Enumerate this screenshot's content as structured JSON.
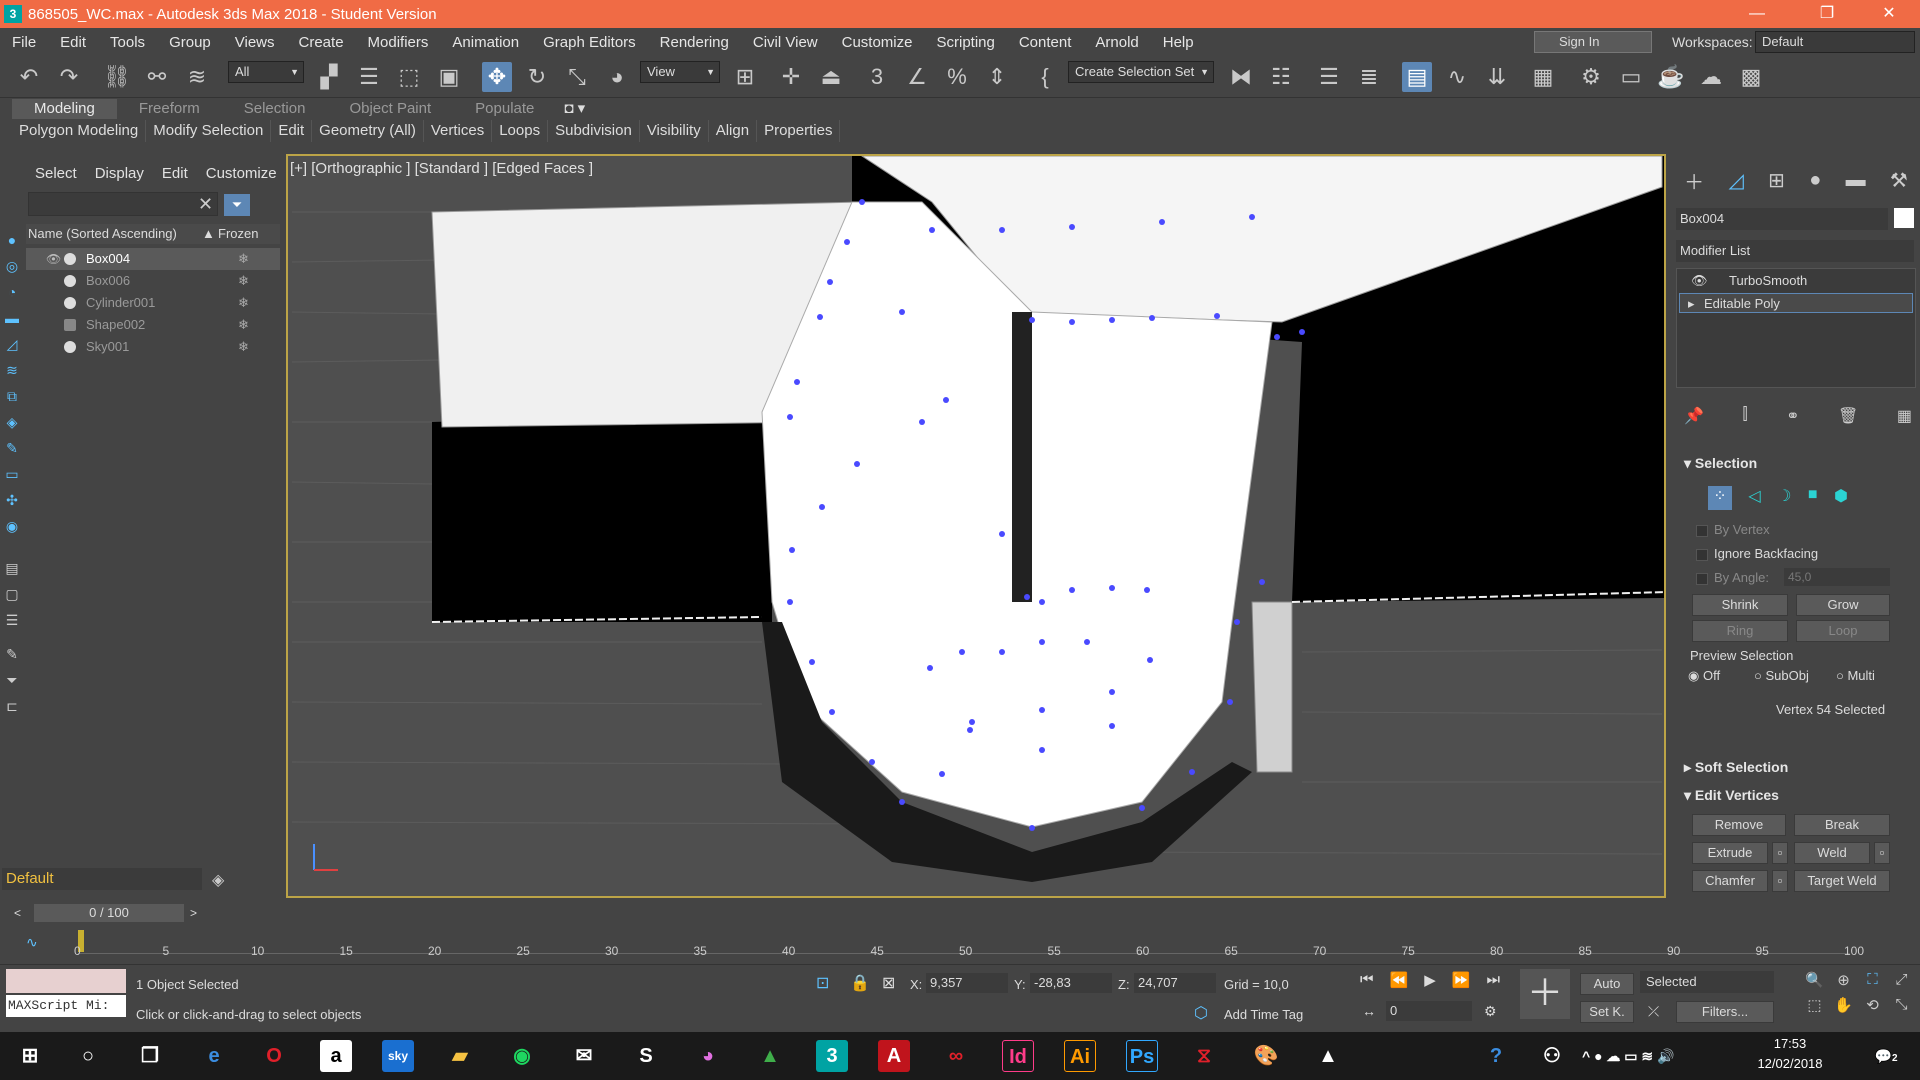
{
  "window": {
    "app_icon": "3",
    "title": "868505_WC.max - Autodesk 3ds Max 2018 - Student Version",
    "minimize": "—",
    "maximize": "❐",
    "close": "✕"
  },
  "menu": [
    "File",
    "Edit",
    "Tools",
    "Group",
    "Views",
    "Create",
    "Modifiers",
    "Animation",
    "Graph Editors",
    "Rendering",
    "Civil View",
    "Customize",
    "Scripting",
    "Content",
    "Arnold",
    "Help"
  ],
  "account": {
    "signin": "Sign In",
    "workspaces_label": "Workspaces:",
    "workspace": "Default"
  },
  "toolbar": {
    "filter": "All",
    "ref_coord": "View",
    "selection_set": "Create Selection Set"
  },
  "ribbon_tabs": [
    "Modeling",
    "Freeform",
    "Selection",
    "Object Paint",
    "Populate"
  ],
  "ribbon_items": [
    "Polygon Modeling",
    "Modify Selection",
    "Edit",
    "Geometry (All)",
    "Vertices",
    "Loops",
    "Subdivision",
    "Visibility",
    "Align",
    "Properties"
  ],
  "scene_explorer": {
    "tabs": [
      "Select",
      "Display",
      "Edit",
      "Customize"
    ],
    "col_name": "Name (Sorted Ascending)",
    "col_frozen": "Frozen",
    "sort_arrow": "▲",
    "items": [
      {
        "name": "Box004"
      },
      {
        "name": "Box006"
      },
      {
        "name": "Cylinder001"
      },
      {
        "name": "Shape002"
      },
      {
        "name": "Sky001"
      }
    ]
  },
  "layer": "Default",
  "viewport": {
    "label": "[+] [Orthographic ] [Standard ] [Edged Faces ]"
  },
  "command_panel": {
    "object_name": "Box004",
    "modifier_list": "Modifier List",
    "modifiers": [
      "TurboSmooth",
      "Editable Poly"
    ],
    "selection": {
      "title": "Selection",
      "by_vertex": "By Vertex",
      "ignore_backfacing": "Ignore Backfacing",
      "by_angle": "By Angle:",
      "angle": "45,0",
      "shrink": "Shrink",
      "grow": "Grow",
      "ring": "Ring",
      "loop": "Loop",
      "preview": "Preview Selection",
      "off": "Off",
      "subobj": "SubObj",
      "multi": "Multi",
      "status": "Vertex 54 Selected"
    },
    "soft_selection": "Soft Selection",
    "edit_vertices": {
      "title": "Edit Vertices",
      "remove": "Remove",
      "break": "Break",
      "extrude": "Extrude",
      "weld": "Weld",
      "chamfer": "Chamfer",
      "target_weld": "Target Weld"
    }
  },
  "timeline": {
    "frame": "0 / 100",
    "ticks": [
      "0",
      "5",
      "10",
      "15",
      "20",
      "25",
      "30",
      "35",
      "40",
      "45",
      "50",
      "55",
      "60",
      "65",
      "70",
      "75",
      "80",
      "85",
      "90",
      "95",
      "100"
    ]
  },
  "status": {
    "objects": "1 Object Selected",
    "prompt": "Click or click-and-drag to select objects",
    "maxscript": "MAXScript Mi:",
    "x_label": "X:",
    "x": "9,357",
    "y_label": "Y:",
    "y": "-28,83",
    "z_label": "Z:",
    "z": "24,707",
    "grid": "Grid = 10,0",
    "add_time_tag": "Add Time Tag",
    "auto": "Auto",
    "setk": "Set K.",
    "key_mode": "Selected",
    "filters": "Filters...",
    "frame_field": "0"
  },
  "taskbar": {
    "time": "17:53",
    "date": "12/02/2018",
    "notif": "2"
  }
}
